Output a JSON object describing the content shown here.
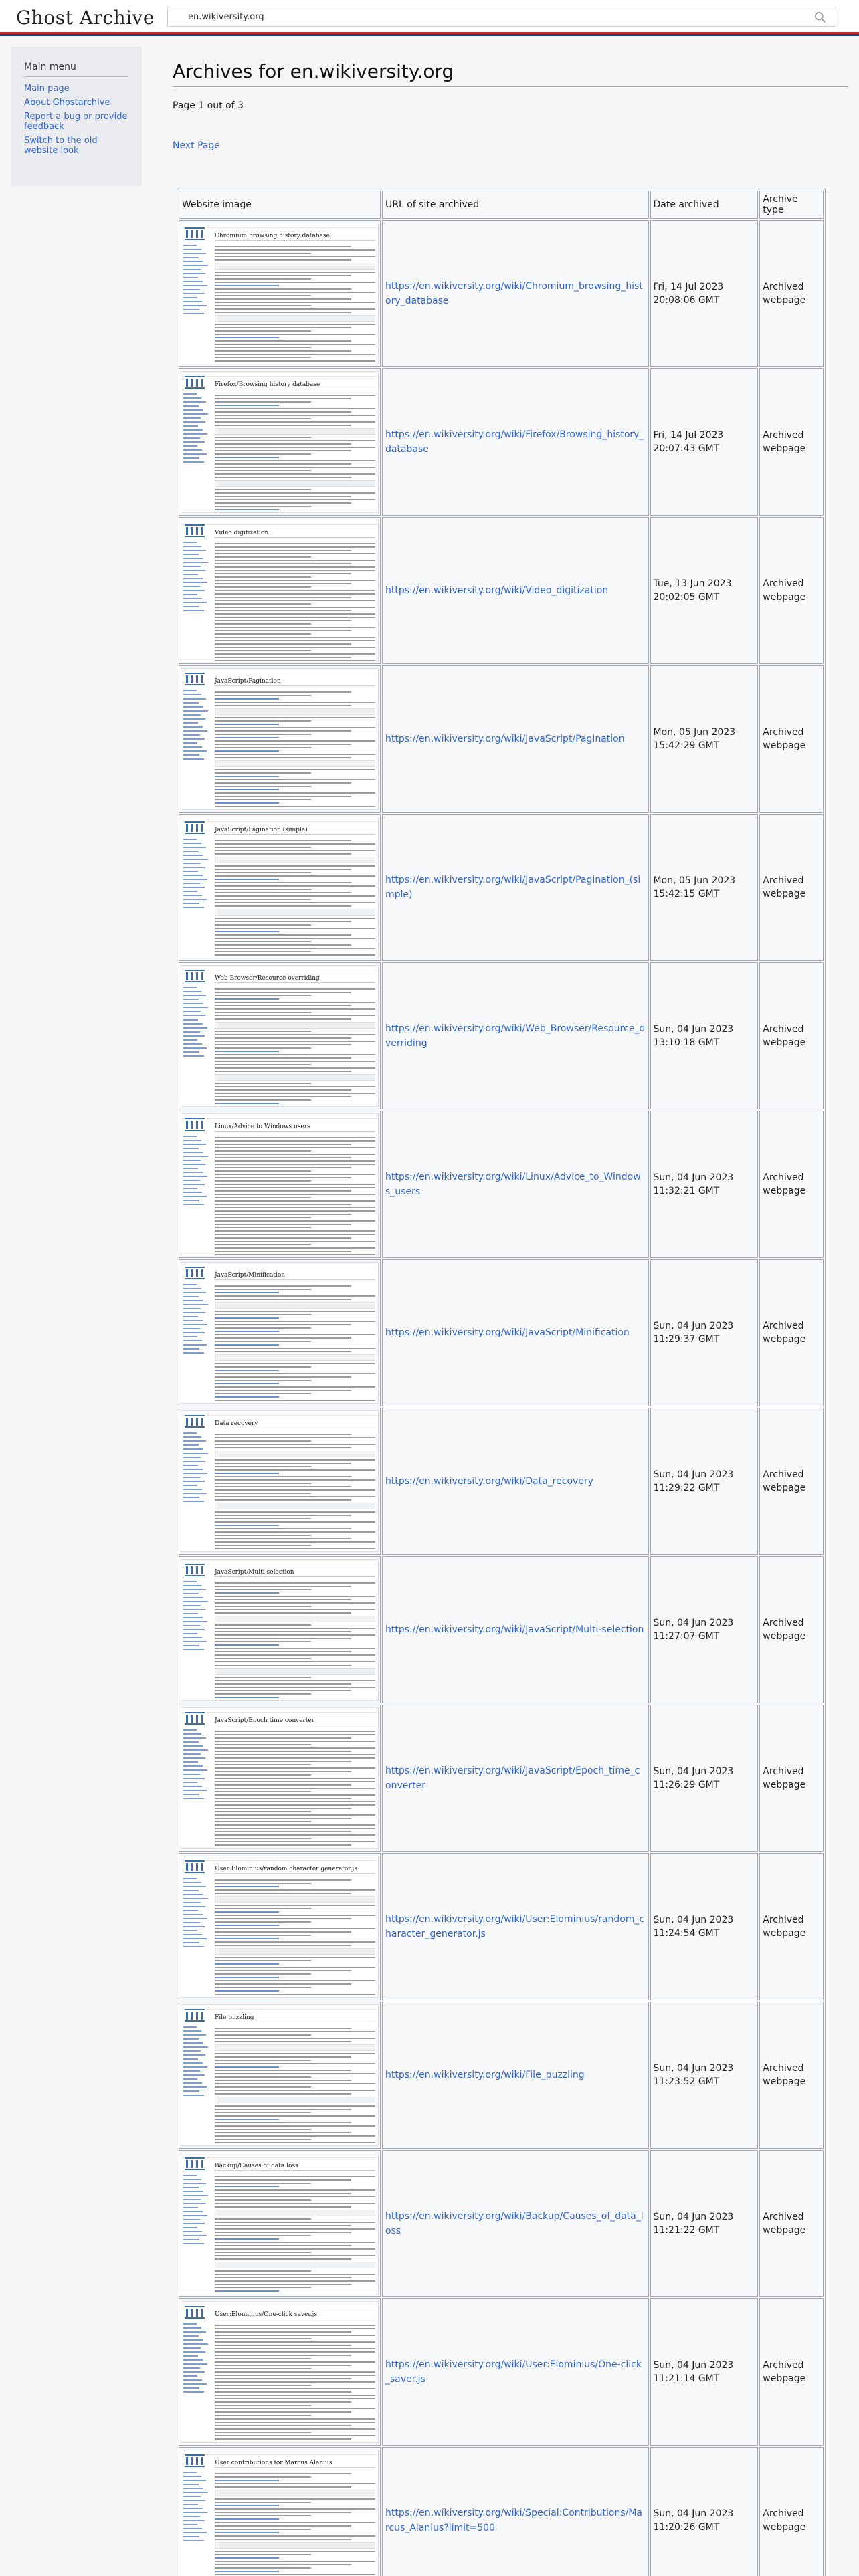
{
  "header": {
    "logo": "Ghost Archive",
    "search_value": "en.wikiversity.org"
  },
  "sidebar": {
    "title": "Main menu",
    "links": [
      "Main page",
      "About Ghostarchive",
      "Report a bug or provide feedback",
      "Switch to the old website look"
    ]
  },
  "main": {
    "title": "Archives for en.wikiversity.org",
    "page_count": "Page 1 out of 3",
    "next_page": "Next Page"
  },
  "table": {
    "headers": [
      "Website image",
      "URL of site archived",
      "Date archived",
      "Archive type"
    ],
    "rows": [
      {
        "thumb_title": "Chromium browsing history database",
        "url": "https://en.wikiversity.org/wiki/Chromium_browsing_history_database",
        "date": "Fri, 14 Jul 2023",
        "time": "20:08:06 GMT",
        "type": "Archived webpage"
      },
      {
        "thumb_title": "Firefox/Browsing history database",
        "url": "https://en.wikiversity.org/wiki/Firefox/Browsing_history_database",
        "date": "Fri, 14 Jul 2023",
        "time": "20:07:43 GMT",
        "type": "Archived webpage"
      },
      {
        "thumb_title": "Video digitization",
        "url": "https://en.wikiversity.org/wiki/Video_digitization",
        "date": "Tue, 13 Jun 2023",
        "time": "20:02:05 GMT",
        "type": "Archived webpage"
      },
      {
        "thumb_title": "JavaScript/Pagination",
        "url": "https://en.wikiversity.org/wiki/JavaScript/Pagination",
        "date": "Mon, 05 Jun 2023",
        "time": "15:42:29 GMT",
        "type": "Archived webpage"
      },
      {
        "thumb_title": "JavaScript/Pagination (simple)",
        "url": "https://en.wikiversity.org/wiki/JavaScript/Pagination_(simple)",
        "date": "Mon, 05 Jun 2023",
        "time": "15:42:15 GMT",
        "type": "Archived webpage"
      },
      {
        "thumb_title": "Web Browser/Resource overriding",
        "url": "https://en.wikiversity.org/wiki/Web_Browser/Resource_overriding",
        "date": "Sun, 04 Jun 2023",
        "time": "13:10:18 GMT",
        "type": "Archived webpage"
      },
      {
        "thumb_title": "Linux/Advice to Windows users",
        "url": "https://en.wikiversity.org/wiki/Linux/Advice_to_Windows_users",
        "date": "Sun, 04 Jun 2023",
        "time": "11:32:21 GMT",
        "type": "Archived webpage"
      },
      {
        "thumb_title": "JavaScript/Minification",
        "url": "https://en.wikiversity.org/wiki/JavaScript/Minification",
        "date": "Sun, 04 Jun 2023",
        "time": "11:29:37 GMT",
        "type": "Archived webpage"
      },
      {
        "thumb_title": "Data recovery",
        "url": "https://en.wikiversity.org/wiki/Data_recovery",
        "date": "Sun, 04 Jun 2023",
        "time": "11:29:22 GMT",
        "type": "Archived webpage"
      },
      {
        "thumb_title": "JavaScript/Multi-selection",
        "url": "https://en.wikiversity.org/wiki/JavaScript/Multi-selection",
        "date": "Sun, 04 Jun 2023",
        "time": "11:27:07 GMT",
        "type": "Archived webpage"
      },
      {
        "thumb_title": "JavaScript/Epoch time converter",
        "url": "https://en.wikiversity.org/wiki/JavaScript/Epoch_time_converter",
        "date": "Sun, 04 Jun 2023",
        "time": "11:26:29 GMT",
        "type": "Archived webpage"
      },
      {
        "thumb_title": "User:Elominius/random character generator.js",
        "url": "https://en.wikiversity.org/wiki/User:Elominius/random_character_generator.js",
        "date": "Sun, 04 Jun 2023",
        "time": "11:24:54 GMT",
        "type": "Archived webpage"
      },
      {
        "thumb_title": "File puzzling",
        "url": "https://en.wikiversity.org/wiki/File_puzzling",
        "date": "Sun, 04 Jun 2023",
        "time": "11:23:52 GMT",
        "type": "Archived webpage"
      },
      {
        "thumb_title": "Backup/Causes of data loss",
        "url": "https://en.wikiversity.org/wiki/Backup/Causes_of_data_loss",
        "date": "Sun, 04 Jun 2023",
        "time": "11:21:22 GMT",
        "type": "Archived webpage"
      },
      {
        "thumb_title": "User:Elominius/One-click saver.js",
        "url": "https://en.wikiversity.org/wiki/User:Elominius/One-click_saver.js",
        "date": "Sun, 04 Jun 2023",
        "time": "11:21:14 GMT",
        "type": "Archived webpage"
      },
      {
        "thumb_title": "User contributions for Marcus Alanius",
        "url": "https://en.wikiversity.org/wiki/Special:Contributions/Marcus_Alanius?limit=500",
        "date": "Sun, 04 Jun 2023",
        "time": "11:20:26 GMT",
        "type": "Archived webpage"
      }
    ]
  },
  "icons": {
    "search": "search-icon",
    "thumb_logo": "wikiversity-logo-icon"
  },
  "colors": {
    "link": "#3366cc",
    "stripe_red": "#c4302b",
    "stripe_blue": "#1a3a8a",
    "sidebar_bg": "#eaecf0"
  }
}
